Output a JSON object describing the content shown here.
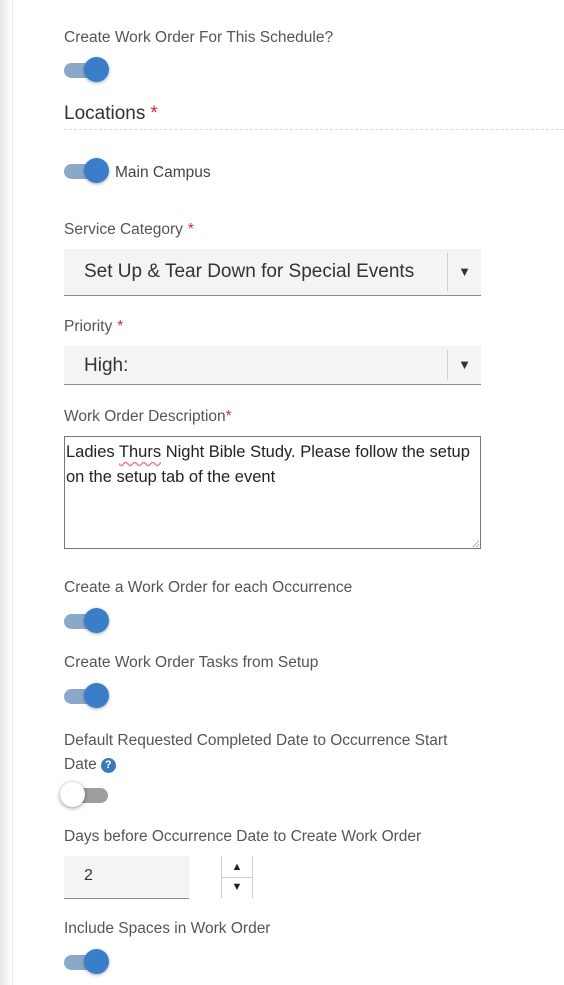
{
  "create_work_order": {
    "label": "Create Work Order For This Schedule?",
    "on": true
  },
  "locations": {
    "title": "Locations",
    "required_mark": "*",
    "items": [
      {
        "label": "Main Campus",
        "on": true
      }
    ]
  },
  "service_category": {
    "label": "Service Category",
    "required_mark": "*",
    "value": "Set Up & Tear Down for Special Events"
  },
  "priority": {
    "label": "Priority",
    "required_mark": "*",
    "value": "High:"
  },
  "description": {
    "label": "Work Order Description",
    "required_mark": "*",
    "text_before": "Ladies ",
    "misspelled": "Thurs",
    "text_after": " Night Bible Study. Please follow the setup on the setup tab of the event"
  },
  "each_occurrence": {
    "label": "Create a Work Order for each Occurrence",
    "on": true
  },
  "tasks_from_setup": {
    "label": "Create Work Order Tasks from Setup",
    "on": true
  },
  "default_date": {
    "label": "Default Requested Completed Date to Occurrence Start Date",
    "help_glyph": "?",
    "on": false
  },
  "days_before": {
    "label": "Days before Occurrence Date to Create Work Order",
    "value": "2"
  },
  "include_spaces": {
    "label": "Include Spaces in Work Order",
    "on": true
  },
  "icons": {
    "dropdown": "caret-down-icon",
    "up": "caret-up-icon",
    "help": "question-circle-icon"
  },
  "colors": {
    "accent": "#3a7dc9",
    "required": "#e0282e",
    "help": "#3d79b5"
  }
}
